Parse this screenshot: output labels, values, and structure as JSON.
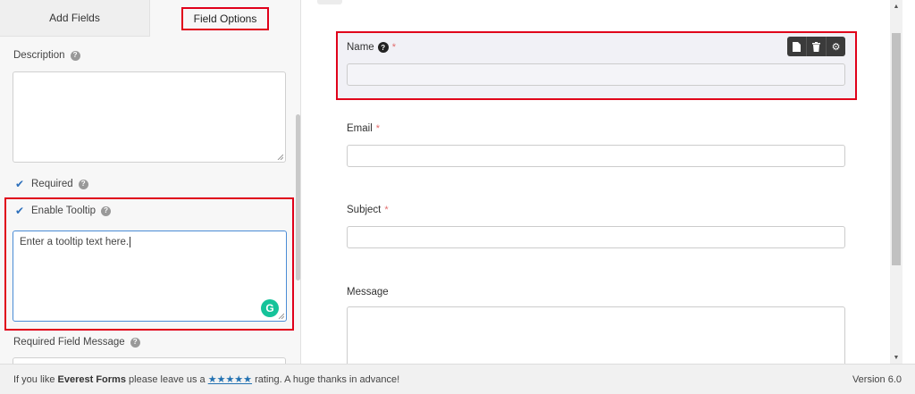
{
  "tabs": {
    "add_fields": "Add Fields",
    "field_options": "Field Options"
  },
  "options": {
    "description_label": "Description",
    "required_label": "Required",
    "enable_tooltip_label": "Enable Tooltip",
    "tooltip_text": "Enter a tooltip text here.",
    "required_field_message_label": "Required Field Message"
  },
  "form": {
    "fields": [
      {
        "label": "Name",
        "required": "*"
      },
      {
        "label": "Email",
        "required": "*"
      },
      {
        "label": "Subject",
        "required": "*"
      },
      {
        "label": "Message"
      }
    ]
  },
  "footer": {
    "text_before": "If you like",
    "brand": "Everest Forms",
    "text_mid": "please leave us a",
    "stars": "★★★★★",
    "text_after": "rating. A huge thanks in advance!",
    "version": "Version 6.0"
  },
  "colors": {
    "highlight": "#e0001a",
    "accent": "#2271b1",
    "grammarly": "#15c39a"
  }
}
